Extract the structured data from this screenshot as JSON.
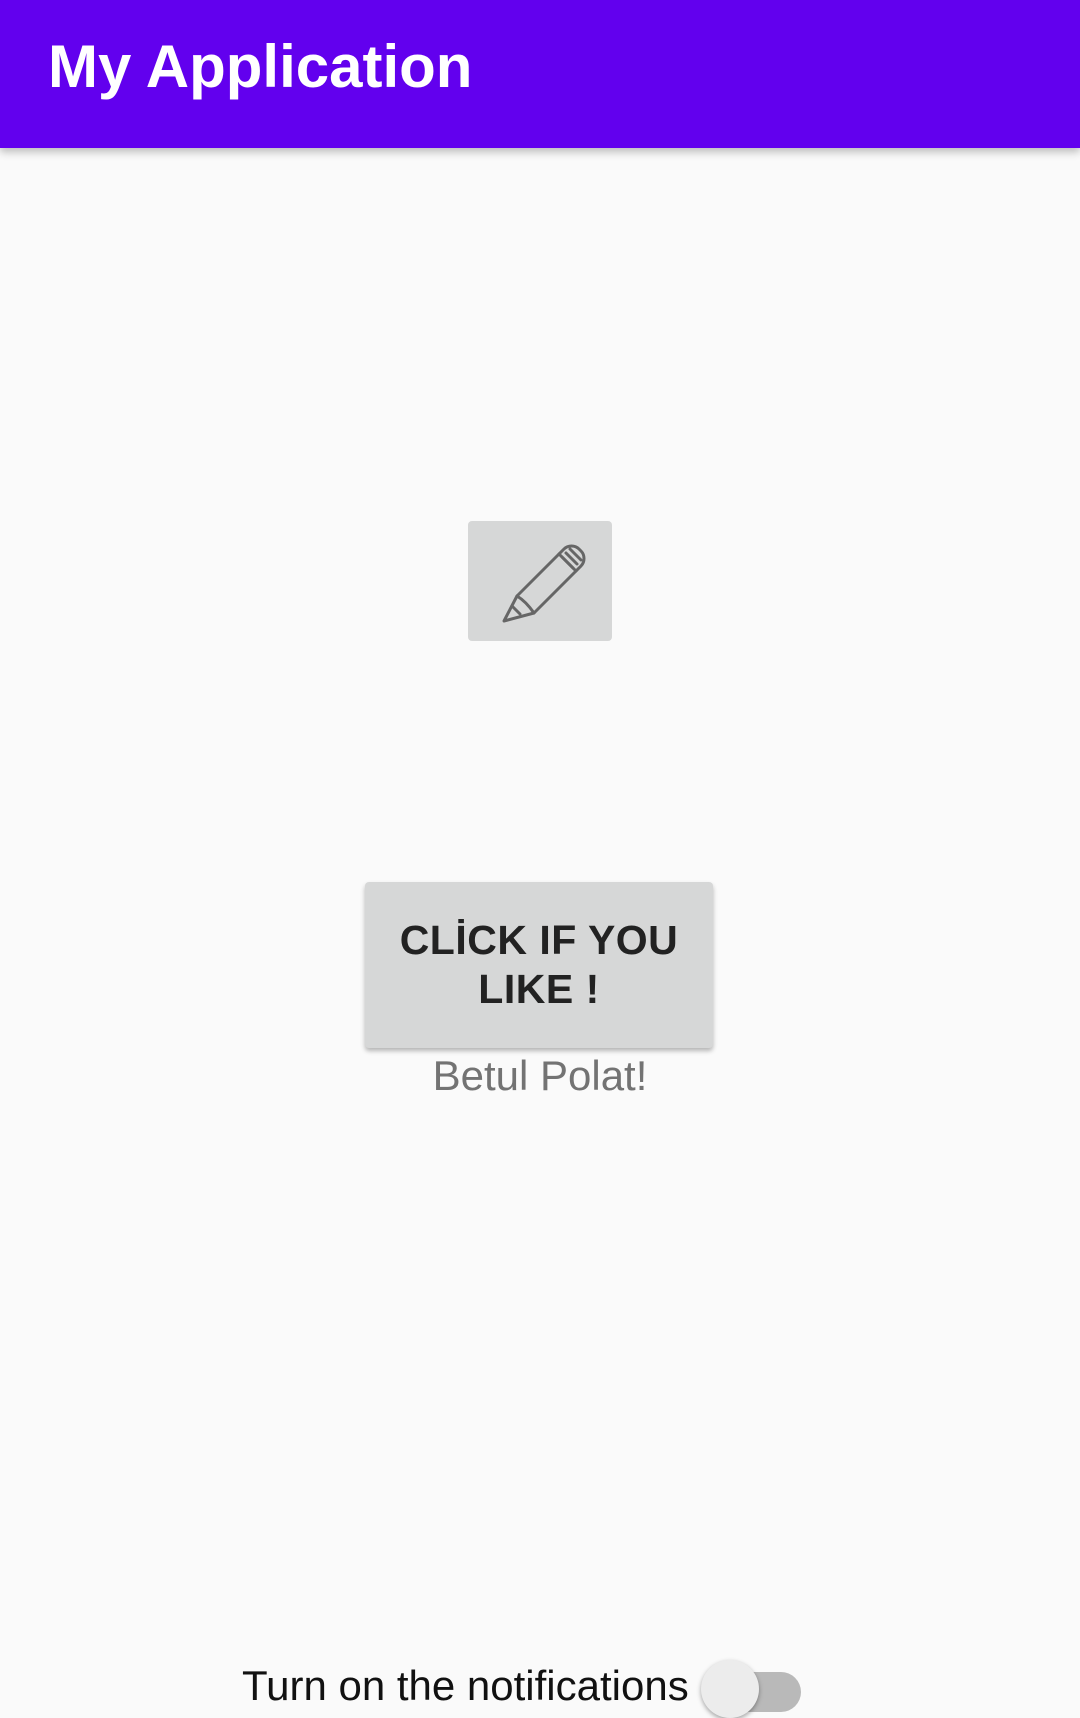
{
  "app_bar": {
    "title": "My Application",
    "color": "#6200ee"
  },
  "main": {
    "image_button": {
      "icon": "pencil-icon"
    },
    "like_button": {
      "label": "CLİCK IF YOU LIKE !"
    },
    "name_text": "Betul Polat!",
    "notifications": {
      "label": "Turn on the notifications",
      "checked": false
    }
  }
}
